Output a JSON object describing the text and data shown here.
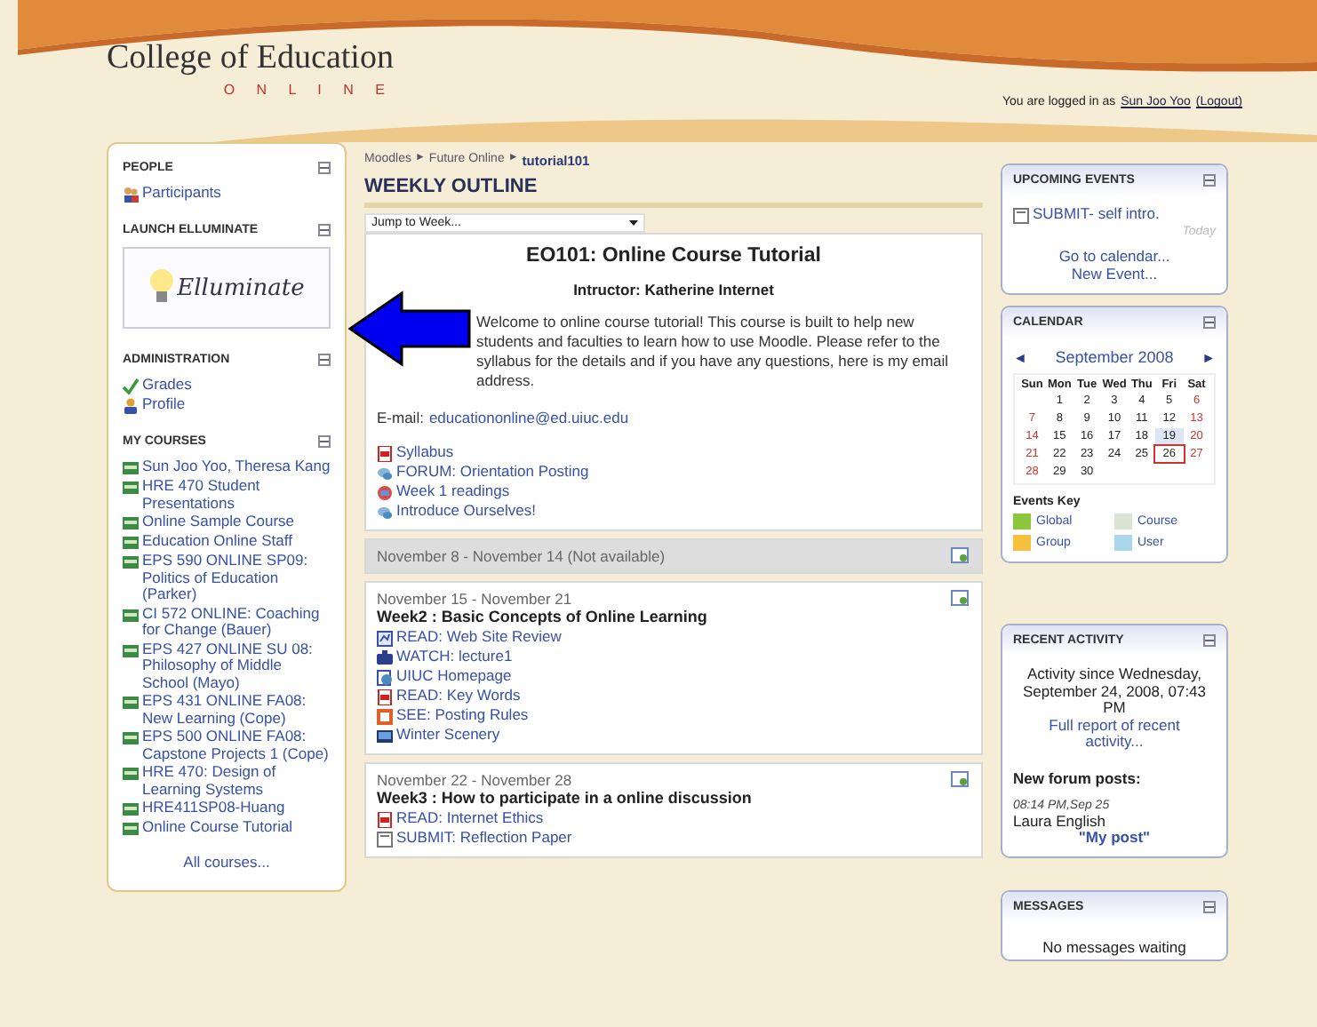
{
  "header": {
    "title": "College of Education",
    "subtitle": "O N L I N E",
    "login_prefix": "You are logged in as",
    "user": "Sun Joo Yoo",
    "logout": "(Logout)"
  },
  "left_blocks": [
    {
      "kind": "people",
      "title": "PEOPLE",
      "items": [
        {
          "label": "Participants",
          "kind": "people"
        }
      ]
    },
    {
      "kind": "logo",
      "title": "LAUNCH ELLUMINATE",
      "logo": "Elluminate"
    },
    {
      "kind": "admin",
      "title": "ADMINISTRATION",
      "items": [
        {
          "label": "Grades",
          "kind": "grades"
        },
        {
          "label": "Profile",
          "kind": "profile"
        }
      ]
    },
    {
      "kind": "courses",
      "title": "MY COURSES",
      "items": [
        {
          "label": "Sun Joo Yoo, Theresa Kang",
          "kind": "course"
        },
        {
          "label": "HRE 470 Student Presentations",
          "kind": "course"
        },
        {
          "label": "Online Sample Course",
          "kind": "course"
        },
        {
          "label": "Education Online Staff",
          "kind": "course"
        },
        {
          "label": "EPS 590 ONLINE SP09: Politics of Education (Parker)",
          "kind": "course"
        },
        {
          "label": "CI 572 ONLINE: Coaching for Change (Bauer)",
          "kind": "course"
        },
        {
          "label": "EPS 427 ONLINE SU 08: Philosophy of Middle School (Mayo)",
          "kind": "course"
        },
        {
          "label": "EPS 431 ONLINE FA08: New Learning (Cope)",
          "kind": "course"
        },
        {
          "label": "EPS 500 ONLINE FA08: Capstone Projects 1 (Cope)",
          "kind": "course"
        },
        {
          "label": "HRE 470: Design of Learning Systems",
          "kind": "course"
        },
        {
          "label": "HRE411SP08-Huang",
          "kind": "course"
        },
        {
          "label": "Online Course Tutorial",
          "kind": "course"
        }
      ],
      "footer": "All courses..."
    }
  ],
  "breadcrumb": [
    "Moodles",
    "Future Online",
    "tutorial101"
  ],
  "breadcrumb_separator": "►",
  "outline_title": "WEEKLY OUTLINE",
  "jump": {
    "value": "Jump to Week..."
  },
  "intro": {
    "title": "EO101: Online Course Tutorial",
    "instructor": "Intructor: Katherine Internet",
    "text": "Welcome to online course tutorial! This course is built to help new students and faculties to learn how to use Moodle. Please refer to the syllabus for the details and if you have any questions, here is my email address.",
    "email_label": "E-mail:",
    "email": "educationonline@ed.uiuc.edu",
    "items": [
      {
        "label": "Syllabus",
        "kind": "pdf"
      },
      {
        "label": "FORUM: Orientation Posting",
        "kind": "forum"
      },
      {
        "label": "Week 1 readings",
        "kind": "book"
      },
      {
        "label": "Introduce Ourselves!",
        "kind": "forum"
      }
    ]
  },
  "weeks": [
    {
      "dates": "November 8 - November 14 (Not available)",
      "available": false
    },
    {
      "dates": "November 15 - November 21",
      "available": true,
      "title": "Week2 : Basic Concepts of Online Learning",
      "items": [
        {
          "label": "READ: Web Site Review",
          "kind": "wiki"
        },
        {
          "label": "WATCH: lecture1",
          "kind": "video"
        },
        {
          "label": "UIUC Homepage",
          "kind": "web"
        },
        {
          "label": "READ: Key Words",
          "kind": "pdf"
        },
        {
          "label": "SEE: Posting Rules",
          "kind": "slides"
        },
        {
          "label": "Winter Scenery",
          "kind": "image"
        }
      ]
    },
    {
      "dates": "November 22 - November 28",
      "available": true,
      "title": "Week3 : How to participate in a online discussion",
      "items": [
        {
          "label": "READ: Internet Ethics",
          "kind": "pdf"
        },
        {
          "label": "SUBMIT: Reflection Paper",
          "kind": "assignment"
        }
      ]
    }
  ],
  "upcoming": {
    "title": "UPCOMING EVENTS",
    "event": "SUBMIT- self intro.",
    "when": "Today",
    "links": [
      "Go to calendar...",
      "New Event..."
    ]
  },
  "calendar": {
    "title": "CALENDAR",
    "month": "September 2008",
    "prev": "◄",
    "next": "►",
    "weekdays": [
      "Sun",
      "Mon",
      "Tue",
      "Wed",
      "Thu",
      "Fri",
      "Sat"
    ],
    "weeks": [
      [
        {
          "day": "1"
        },
        {
          "day": "2"
        },
        {
          "day": "3"
        },
        {
          "day": "4"
        },
        {
          "day": "5"
        },
        {
          "day": "6"
        }
      ],
      [
        {
          "day": "7"
        },
        {
          "day": "8"
        },
        {
          "day": "9"
        },
        {
          "day": "10"
        },
        {
          "day": "11"
        },
        {
          "day": "12"
        },
        {
          "day": "13"
        }
      ],
      [
        {
          "day": "14"
        },
        {
          "day": "15"
        },
        {
          "day": "16"
        },
        {
          "day": "17"
        },
        {
          "day": "18"
        },
        {
          "day": "19",
          "event": true
        },
        {
          "day": "20"
        }
      ],
      [
        {
          "day": "21"
        },
        {
          "day": "22"
        },
        {
          "day": "23"
        },
        {
          "day": "24"
        },
        {
          "day": "25"
        },
        {
          "day": "26",
          "today": true
        },
        {
          "day": "27"
        }
      ],
      [
        {
          "day": "28"
        },
        {
          "day": "29"
        },
        {
          "day": "30"
        }
      ]
    ],
    "key_title": "Events Key",
    "key": [
      {
        "label": "Global",
        "color": "#8cc63f"
      },
      {
        "label": "Course",
        "color": "#d9e4d2"
      },
      {
        "label": "Group",
        "color": "#f5c040"
      },
      {
        "label": "User",
        "color": "#a8d8ea"
      }
    ]
  },
  "recent": {
    "title": "RECENT ACTIVITY",
    "since": "Activity since Wednesday, September 24, 2008, 07:43 PM",
    "report": "Full report of recent activity...",
    "posts_title": "New forum posts:",
    "time": "08:14 PM,Sep 25",
    "author": "Laura English",
    "post": "\"My post\""
  },
  "messages": {
    "title": "MESSAGES",
    "text": "No messages waiting"
  }
}
